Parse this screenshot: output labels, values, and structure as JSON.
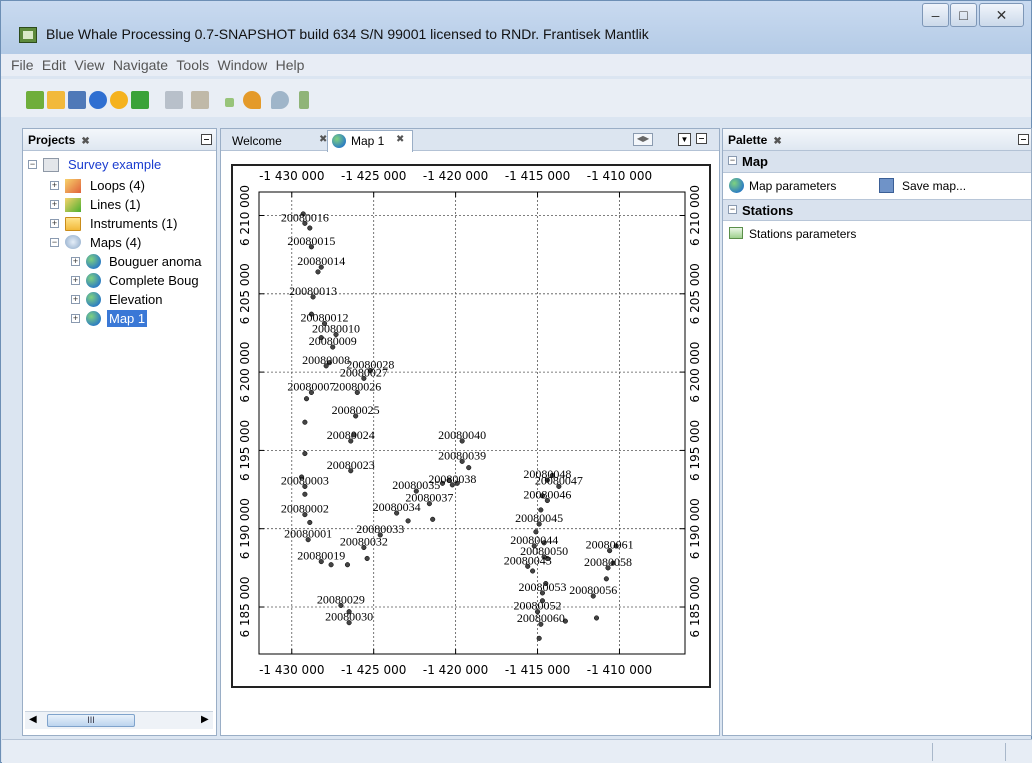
{
  "window": {
    "title": "Blue Whale Processing 0.7-SNAPSHOT build 634 S/N 99001 licensed to RNDr. Frantisek Mantlik",
    "buttons": [
      "minimize",
      "maximize",
      "close"
    ]
  },
  "menu": [
    "File",
    "Edit",
    "View",
    "Navigate",
    "Tools",
    "Window",
    "Help"
  ],
  "toolbar_icons": [
    "new-project-icon",
    "open-project-icon",
    "save-icon",
    "info-icon",
    "refresh-icon",
    "sync-icon",
    "copy-icon",
    "paste-icon",
    "add-icon",
    "undo-icon",
    "redo-icon",
    "flag-icon"
  ],
  "projects": {
    "title": "Projects",
    "root": "Survey example",
    "nodes": [
      {
        "label": "Loops (4)",
        "icon": "loops-icon"
      },
      {
        "label": "Lines (1)",
        "icon": "lines-icon"
      },
      {
        "label": "Instruments (1)",
        "icon": "folder-icon"
      },
      {
        "label": "Maps (4)",
        "icon": "maps-icon"
      }
    ],
    "maps": [
      "Bouguer anoma",
      "Complete Boug",
      "Elevation",
      "Map 1"
    ],
    "scroll_label": "III"
  },
  "editor": {
    "tabs": [
      {
        "label": "Welcome",
        "selected": false
      },
      {
        "label": "Map 1",
        "selected": true
      }
    ]
  },
  "palette": {
    "title": "Palette",
    "sections": [
      {
        "label": "Map",
        "items": [
          "Map parameters",
          "Save map..."
        ]
      },
      {
        "label": "Stations",
        "items": [
          "Stations parameters"
        ]
      }
    ]
  },
  "map": {
    "x_ticks": [
      "-1 430 000",
      "-1 425 000",
      "-1 420 000",
      "-1 415 000",
      "-1 410 000"
    ],
    "y_ticks": [
      "6 210 000",
      "6 205 000",
      "6 200 000",
      "6 195 000",
      "6 190 000",
      "6 185 000"
    ],
    "x_values": [
      -1430000,
      -1425000,
      -1420000,
      -1415000,
      -1410000
    ],
    "y_values": [
      6210000,
      6205000,
      6200000,
      6195000,
      6190000,
      6185000
    ],
    "stations": [
      {
        "label": "20080016",
        "x": -1429200,
        "y": 6209500
      },
      {
        "label": "20080015",
        "x": -1428800,
        "y": 6208000
      },
      {
        "label": "20080014",
        "x": -1428200,
        "y": 6206700
      },
      {
        "label": "20080013",
        "x": -1428700,
        "y": 6204800
      },
      {
        "label": "20080012",
        "x": -1428000,
        "y": 6203100
      },
      {
        "label": "20080010",
        "x": -1427300,
        "y": 6202400
      },
      {
        "label": "20080009",
        "x": -1427500,
        "y": 6201600
      },
      {
        "label": "20080008",
        "x": -1427900,
        "y": 6200400
      },
      {
        "label": "20080028",
        "x": -1425200,
        "y": 6200100
      },
      {
        "label": "20080027",
        "x": -1425600,
        "y": 6199600
      },
      {
        "label": "20080007",
        "x": -1428800,
        "y": 6198700
      },
      {
        "label": "20080026",
        "x": -1426000,
        "y": 6198700
      },
      {
        "label": "20080025",
        "x": -1426100,
        "y": 6197200
      },
      {
        "label": "20080024",
        "x": -1426400,
        "y": 6195600
      },
      {
        "label": "20080040",
        "x": -1419600,
        "y": 6195600
      },
      {
        "label": "20080039",
        "x": -1419600,
        "y": 6194300
      },
      {
        "label": "20080023",
        "x": -1426400,
        "y": 6193700
      },
      {
        "label": "20080048",
        "x": -1414400,
        "y": 6193100
      },
      {
        "label": "20080047",
        "x": -1413700,
        "y": 6192700
      },
      {
        "label": "20080038",
        "x": -1420200,
        "y": 6192800
      },
      {
        "label": "20080003",
        "x": -1429200,
        "y": 6192700
      },
      {
        "label": "20080035",
        "x": -1422400,
        "y": 6192400
      },
      {
        "label": "20080046",
        "x": -1414400,
        "y": 6191800
      },
      {
        "label": "20080037",
        "x": -1421600,
        "y": 6191600
      },
      {
        "label": "20080034",
        "x": -1423600,
        "y": 6191000
      },
      {
        "label": "20080002",
        "x": -1429200,
        "y": 6190900
      },
      {
        "label": "20080045",
        "x": -1414900,
        "y": 6190300
      },
      {
        "label": "20080033",
        "x": -1424600,
        "y": 6189600
      },
      {
        "label": "20080001",
        "x": -1429000,
        "y": 6189300
      },
      {
        "label": "20080032",
        "x": -1425600,
        "y": 6188800
      },
      {
        "label": "20080044",
        "x": -1415200,
        "y": 6188900
      },
      {
        "label": "20080061",
        "x": -1410600,
        "y": 6188600
      },
      {
        "label": "20080050",
        "x": -1414600,
        "y": 6188200
      },
      {
        "label": "20080019",
        "x": -1428200,
        "y": 6187900
      },
      {
        "label": "20080043",
        "x": -1415600,
        "y": 6187600
      },
      {
        "label": "20080058",
        "x": -1410700,
        "y": 6187500
      },
      {
        "label": "20080053",
        "x": -1414700,
        "y": 6185900
      },
      {
        "label": "20080056",
        "x": -1411600,
        "y": 6185700
      },
      {
        "label": "20080029",
        "x": -1427000,
        "y": 6185100
      },
      {
        "label": "20080052",
        "x": -1415000,
        "y": 6184700
      },
      {
        "label": "20080030",
        "x": -1426500,
        "y": 6184000
      },
      {
        "label": "20080060",
        "x": -1414800,
        "y": 6183900
      }
    ],
    "extra_points": [
      [
        -1429300,
        6210100
      ],
      [
        -1428900,
        6209200
      ],
      [
        -1428400,
        6206400
      ],
      [
        -1428800,
        6203700
      ],
      [
        -1428200,
        6202200
      ],
      [
        -1427700,
        6200600
      ],
      [
        -1429100,
        6198300
      ],
      [
        -1429200,
        6196800
      ],
      [
        -1429200,
        6194800
      ],
      [
        -1429400,
        6193300
      ],
      [
        -1429200,
        6192200
      ],
      [
        -1428900,
        6190400
      ],
      [
        -1427600,
        6187700
      ],
      [
        -1426600,
        6187700
      ],
      [
        -1425400,
        6188100
      ],
      [
        -1422900,
        6190500
      ],
      [
        -1421400,
        6190600
      ],
      [
        -1420400,
        6193100
      ],
      [
        -1420800,
        6192900
      ],
      [
        -1419900,
        6192900
      ],
      [
        -1419200,
        6193900
      ],
      [
        -1414100,
        6193400
      ],
      [
        -1414700,
        6192100
      ],
      [
        -1414800,
        6191200
      ],
      [
        -1415100,
        6189800
      ],
      [
        -1414600,
        6189100
      ],
      [
        -1414400,
        6188100
      ],
      [
        -1415300,
        6187300
      ],
      [
        -1414500,
        6186500
      ],
      [
        -1414700,
        6185400
      ],
      [
        -1413300,
        6184100
      ],
      [
        -1414900,
        6183000
      ],
      [
        -1411400,
        6184300
      ],
      [
        -1410800,
        6186800
      ],
      [
        -1410400,
        6187800
      ],
      [
        -1410200,
        6188900
      ],
      [
        -1426500,
        6184700
      ],
      [
        -1426200,
        6196000
      ]
    ]
  },
  "colors": {
    "title_bg": "#c9daf0",
    "selection": "#3a78d6",
    "tree_link": "#1a3ccf",
    "frame_bg": "#dbe5f1"
  }
}
